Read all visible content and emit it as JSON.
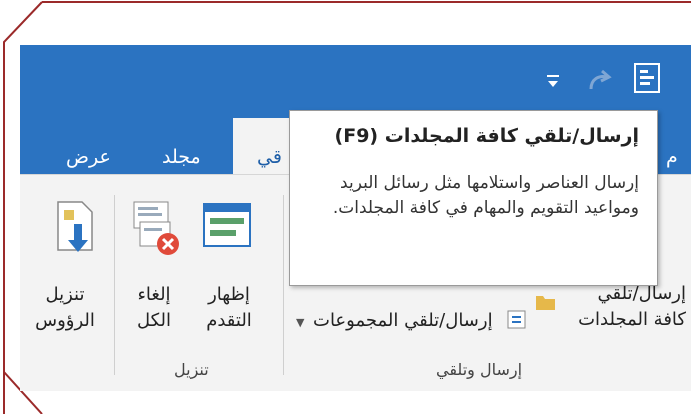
{
  "tabs": [
    {
      "label": "عرض"
    },
    {
      "label": "مجلد"
    },
    {
      "label": "قي"
    },
    {
      "label": "م"
    }
  ],
  "tooltip": {
    "title": "إرسال/تلقي كافة المجلدات (F9)",
    "body": "إرسال العناصر واستلامها مثل رسائل البريد ومواعيد التقويم والمهام في كافة المجلدات."
  },
  "ribbon": {
    "download_headers": {
      "line1": "تنزيل",
      "line2": "الرؤوس"
    },
    "cancel_all": {
      "line1": "إلغاء",
      "line2": "الكل"
    },
    "show_progress": {
      "line1": "إظهار",
      "line2": "التقدم"
    },
    "send_receive_groups": "إرسال/تلقي المجموعات",
    "send_receive_all": {
      "line1": "إرسال/تلقي",
      "line2": "كافة المجلدات"
    },
    "group_download": "تنزيل",
    "group_send_receive": "إرسال وتلقي"
  },
  "colors": {
    "accent": "#2b73c1",
    "frame": "#9b2a2a"
  },
  "icons": [
    "send-receive-qat-icon",
    "redo-icon",
    "customize-dropdown-icon",
    "download-headers-icon",
    "cancel-all-icon",
    "show-progress-icon",
    "folder-icon",
    "send-receive-groups-icon"
  ]
}
